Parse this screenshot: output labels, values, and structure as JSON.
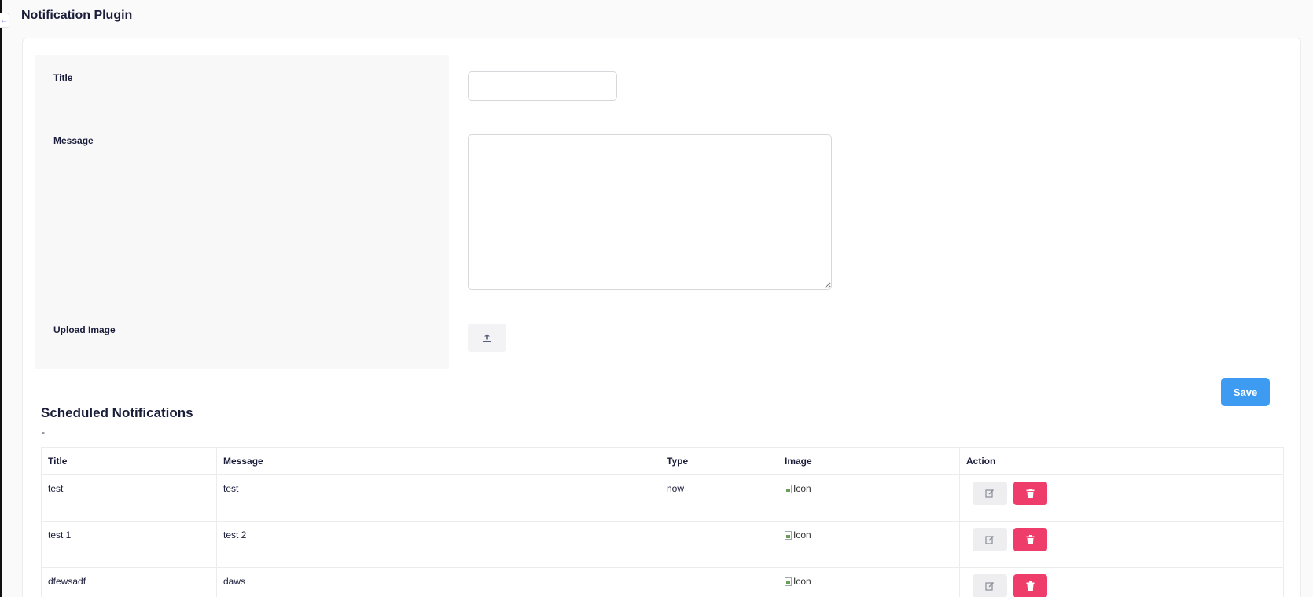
{
  "page": {
    "title": "Notification Plugin",
    "collapse_icon": "arrow-left-icon"
  },
  "form": {
    "title_label": "Title",
    "title_value": "",
    "message_label": "Message",
    "message_value": "",
    "upload_label": "Upload Image",
    "upload_icon": "upload-icon",
    "save_label": "Save"
  },
  "scheduled": {
    "title": "Scheduled Notifications",
    "subtitle": "-",
    "columns": [
      "Title",
      "Message",
      "Type",
      "Image",
      "Action"
    ],
    "rows": [
      {
        "title": "test",
        "message": "test",
        "type": "now",
        "image_alt": "Icon"
      },
      {
        "title": "test 1",
        "message": "test 2",
        "type": "",
        "image_alt": "Icon"
      },
      {
        "title": "dfewsadf",
        "message": "daws",
        "type": "",
        "image_alt": "Icon"
      }
    ]
  },
  "colors": {
    "accent": "#3d9cf2",
    "danger": "#ee3d6b"
  }
}
